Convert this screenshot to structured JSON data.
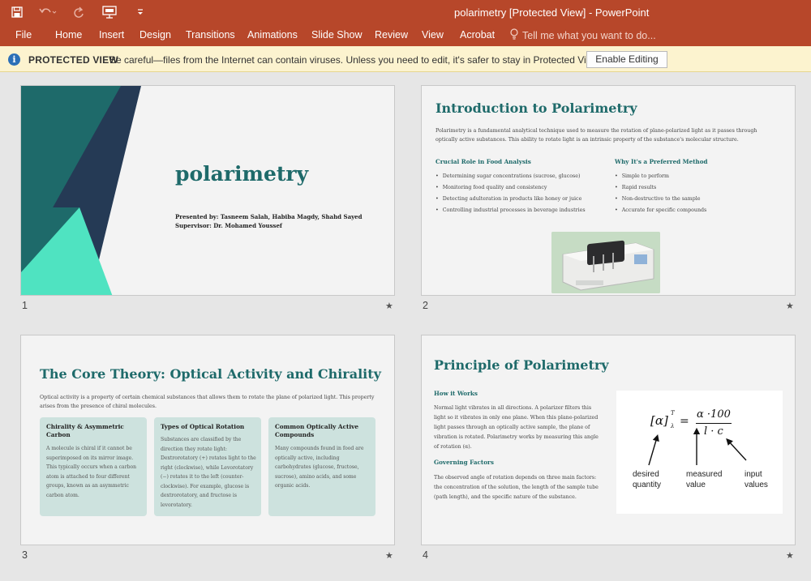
{
  "window": {
    "title": "polarimetry  [Protected View] - PowerPoint"
  },
  "quick_access": {
    "icons": [
      "save-icon",
      "undo-icon",
      "redo-icon",
      "present-from-start-icon",
      "customize-toolbar-icon"
    ]
  },
  "ribbon": {
    "tabs": [
      "File",
      "Home",
      "Insert",
      "Design",
      "Transitions",
      "Animations",
      "Slide Show",
      "Review",
      "View",
      "Acrobat"
    ],
    "tell_me": "Tell me what you want to do..."
  },
  "protected_view": {
    "title": "PROTECTED VIEW",
    "message": "Be careful—files from the Internet can contain viruses. Unless you need to edit, it's safer to stay in Protected View.",
    "button": "Enable Editing"
  },
  "slides": [
    {
      "number": "1",
      "title": "polarimetry",
      "presented_by": "Presented by: Tasneem Salah, Habiba Magdy, Shahd Sayed",
      "supervisor": "Supervisor: Dr. Mohamed Youssef"
    },
    {
      "number": "2",
      "title": "Introduction to Polarimetry",
      "intro": "Polarimetry is a fundamental analytical technique used to measure the rotation of plane-polarized light as it passes through optically active substances. This ability to rotate light is an intrinsic property of the substance's molecular structure.",
      "left_heading": "Crucial Role in Food Analysis",
      "left_items": [
        "Determining sugar concentrations (sucrose, glucose)",
        "Monitoring food quality and consistency",
        "Detecting adulteration in products like honey or juice",
        "Controlling industrial processes in beverage industries"
      ],
      "right_heading": "Why It's a Preferred Method",
      "right_items": [
        "Simple to perform",
        "Rapid results",
        "Non-destructive to the sample",
        "Accurate for specific compounds"
      ]
    },
    {
      "number": "3",
      "title": "The Core Theory: Optical Activity and Chirality",
      "intro": "Optical activity is a property of certain chemical substances that allows them to rotate the plane of polarized light. This property arises from the presence of chiral molecules.",
      "cards": [
        {
          "title": "Chirality & Asymmetric Carbon",
          "body": "A molecule is chiral if it cannot be superimposed on its mirror image. This typically occurs when a carbon atom is attached to four different groups, known as an asymmetric carbon atom."
        },
        {
          "title": "Types of Optical Rotation",
          "body": "Substances are classified by the direction they rotate light: Dextrorotatory (+) rotates light to the right (clockwise), while Levorotatory (−) rotates it to the left (counter-clockwise). For example, glucose is dextrorotatory, and fructose is levorotatory."
        },
        {
          "title": "Common Optically Active Compounds",
          "body": "Many compounds found in food are optically active, including carbohydrates (glucose, fructose, sucrose), amino acids, and some organic acids."
        }
      ]
    },
    {
      "number": "4",
      "title": "Principle of Polarimetry",
      "how_heading": "How it Works",
      "how_body": "Normal light vibrates in all directions. A polarizer filters this light so it vibrates in only one plane. When this plane-polarized light passes through an optically active sample, the plane of vibration is rotated. Polarimetry works by measuring this angle of rotation (α).",
      "gov_heading": "Governing Factors",
      "gov_body": "The observed angle of rotation depends on three main factors: the concentration of the solution, the length of the sample tube (path length), and the specific nature of the substance.",
      "formula": {
        "lhs": "[α]",
        "sup": "T",
        "sub": "λ",
        "equals": "=",
        "numerator": "α ·100",
        "denominator": "l · c",
        "labels": [
          "desired quantity",
          "measured value",
          "input values"
        ]
      }
    }
  ],
  "colors": {
    "brand": "#b7472a",
    "teal": "#1e6a6a",
    "mint": "#4fe3c1",
    "navy": "#253a55"
  }
}
